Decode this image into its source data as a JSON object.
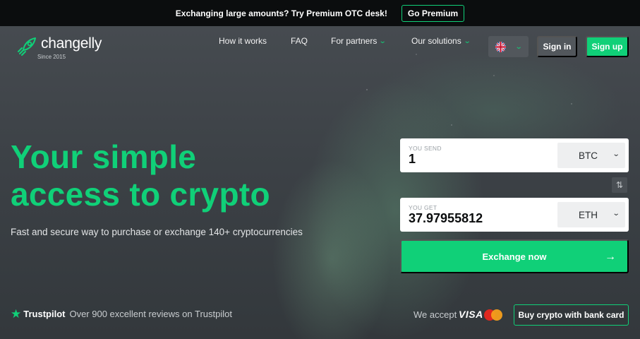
{
  "banner": {
    "text": "Exchanging large amounts? Try Premium OTC desk!",
    "button": "Go Premium"
  },
  "header": {
    "logo_text": "changelly",
    "logo_sub": "Since 2015",
    "nav": [
      "How it works",
      "FAQ",
      "For partners",
      "Our solutions"
    ],
    "sign_in": "Sign in",
    "sign_up": "Sign up"
  },
  "hero": {
    "headline_line1": "Your simple",
    "headline_line2": "access to crypto",
    "subline": "Fast and secure way to purchase or exchange 140+ cryptocurrencies"
  },
  "exchange": {
    "send_label": "YOU SEND",
    "send_value": "1",
    "send_currency": "BTC",
    "get_label": "YOU GET",
    "get_value": "37.97955812",
    "get_currency": "ETH",
    "button": "Exchange now"
  },
  "footer": {
    "trustpilot": "Trustpilot",
    "reviews": "Over 900 excellent reviews on Trustpilot",
    "we_accept": "We accept",
    "visa": "VISA",
    "bank_button": "Buy crypto with bank card"
  },
  "colors": {
    "accent": "#10d078",
    "banner_bg": "#0b0d0e",
    "hero_bg": "#3c4146"
  },
  "icons": {
    "logo": "rocket-icon",
    "nav_dropdown": "chevron-down-icon",
    "language": "uk-flag-icon",
    "swap": "swap-arrows-icon",
    "exchange": "arrow-right-icon",
    "trustpilot": "star-icon",
    "card": "mastercard-icon"
  }
}
